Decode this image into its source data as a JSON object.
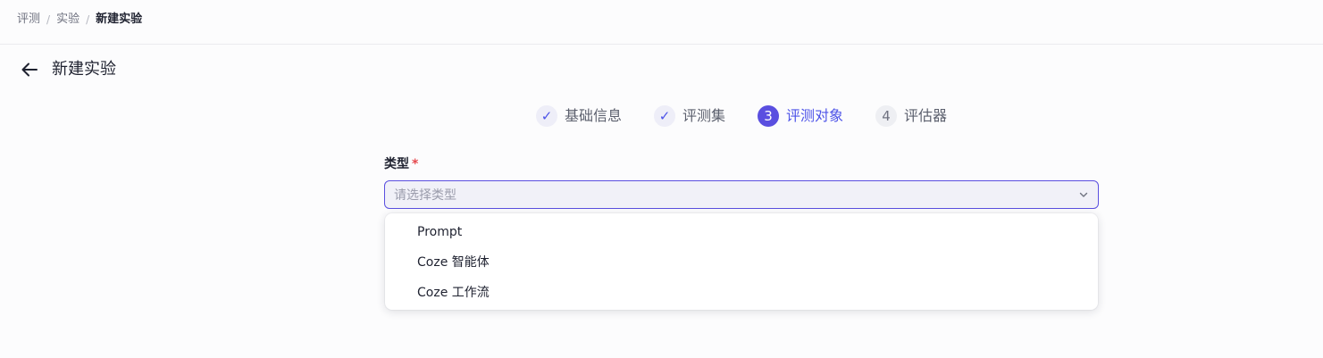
{
  "breadcrumb": {
    "items": [
      "评测",
      "实验",
      "新建实验"
    ],
    "separator": "/"
  },
  "header": {
    "title": "新建实验"
  },
  "steps": [
    {
      "label": "基础信息",
      "status": "done",
      "mark": "✓"
    },
    {
      "label": "评测集",
      "status": "done",
      "mark": "✓"
    },
    {
      "label": "评测对象",
      "status": "active",
      "mark": "3"
    },
    {
      "label": "评估器",
      "status": "todo",
      "mark": "4"
    }
  ],
  "form": {
    "type_label": "类型",
    "required_mark": "*",
    "type_placeholder": "请选择类型",
    "options": [
      "Prompt",
      "Coze 智能体",
      "Coze 工作流"
    ]
  },
  "colors": {
    "accent": "#5a4fe0",
    "required": "#e5484d",
    "text": "#1f2230"
  }
}
